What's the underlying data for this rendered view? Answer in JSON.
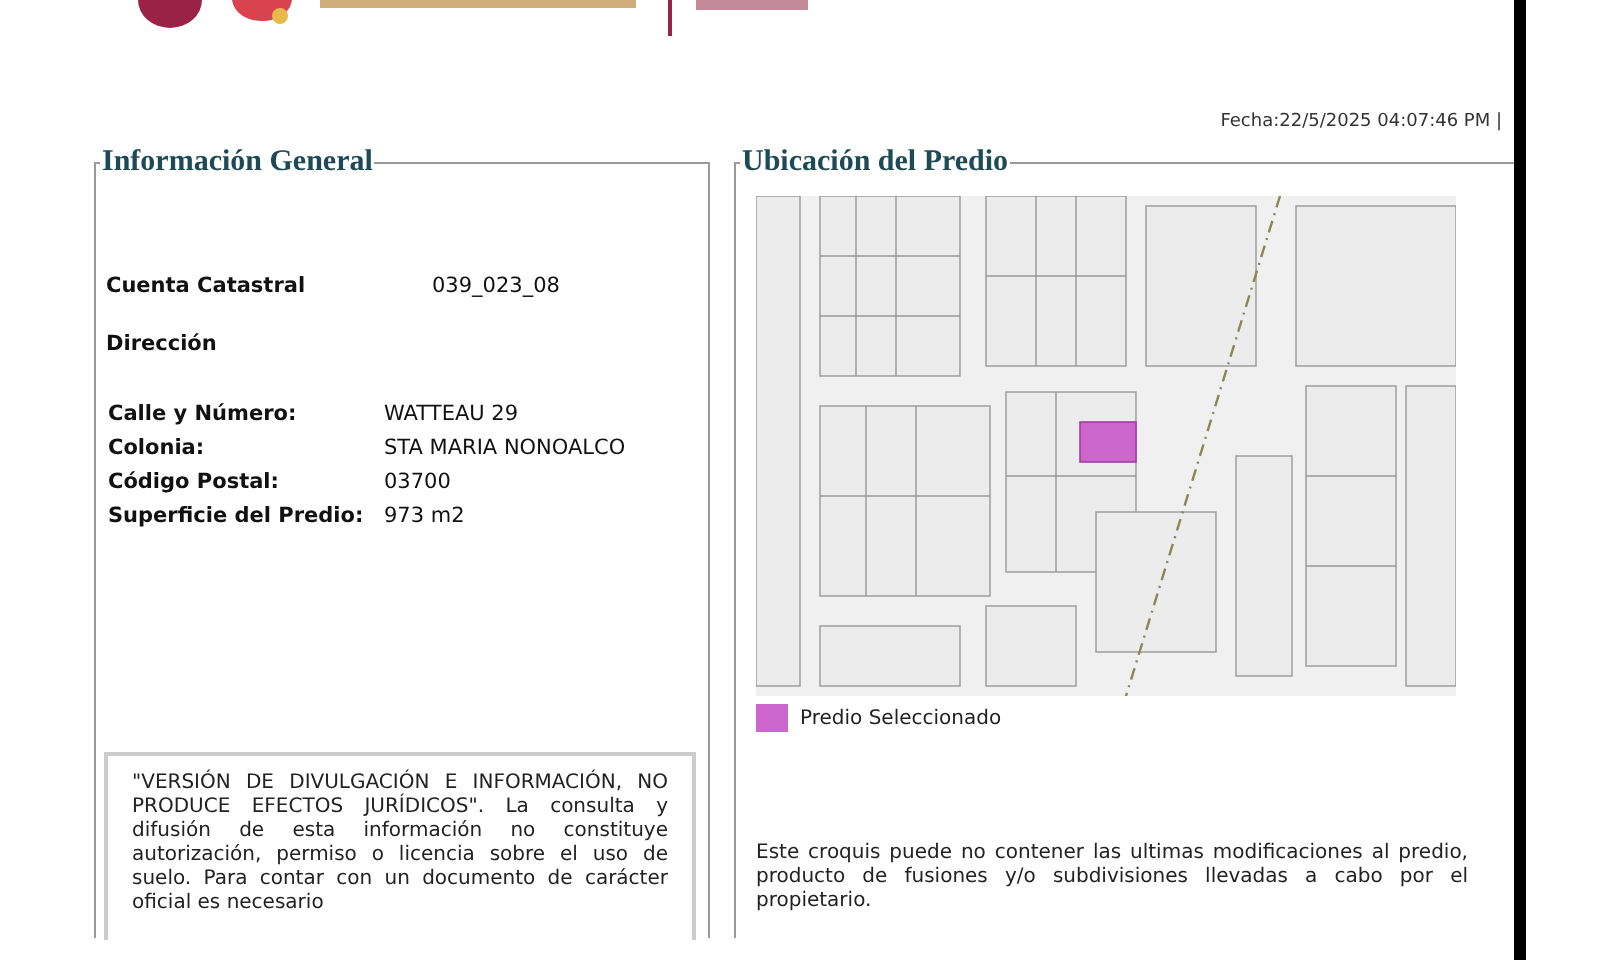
{
  "date_stamp": "Fecha:22/5/2025 04:07:46 PM |",
  "general_info": {
    "title": "Información General",
    "account": {
      "label": "Cuenta Catastral",
      "value": "039_023_08"
    },
    "address_heading": "Dirección",
    "fields": [
      {
        "label": "Calle y Número:",
        "value": "WATTEAU 29"
      },
      {
        "label": "Colonia:",
        "value": "STA MARIA NONOALCO"
      },
      {
        "label": "Código Postal:",
        "value": "03700"
      },
      {
        "label": "Superficie del Predio:",
        "value": "973 m2"
      }
    ],
    "disclaimer": "\"VERSIÓN DE DIVULGACIÓN E INFORMACIÓN, NO PRODUCE EFECTOS JURÍDICOS\". La consulta y difusión de esta información no constituye autorización, permiso o licencia sobre el uso de suelo. Para contar con un documento de carácter oficial es necesario"
  },
  "location": {
    "title": "Ubicación del Predio",
    "legend": {
      "label": "Predio Seleccionado",
      "color": "#cc66cc"
    },
    "note": "Este croquis puede no contener las ultimas modificaciones al predio, producto de fusiones y/o subdivisiones llevadas a cabo por el propietario."
  }
}
